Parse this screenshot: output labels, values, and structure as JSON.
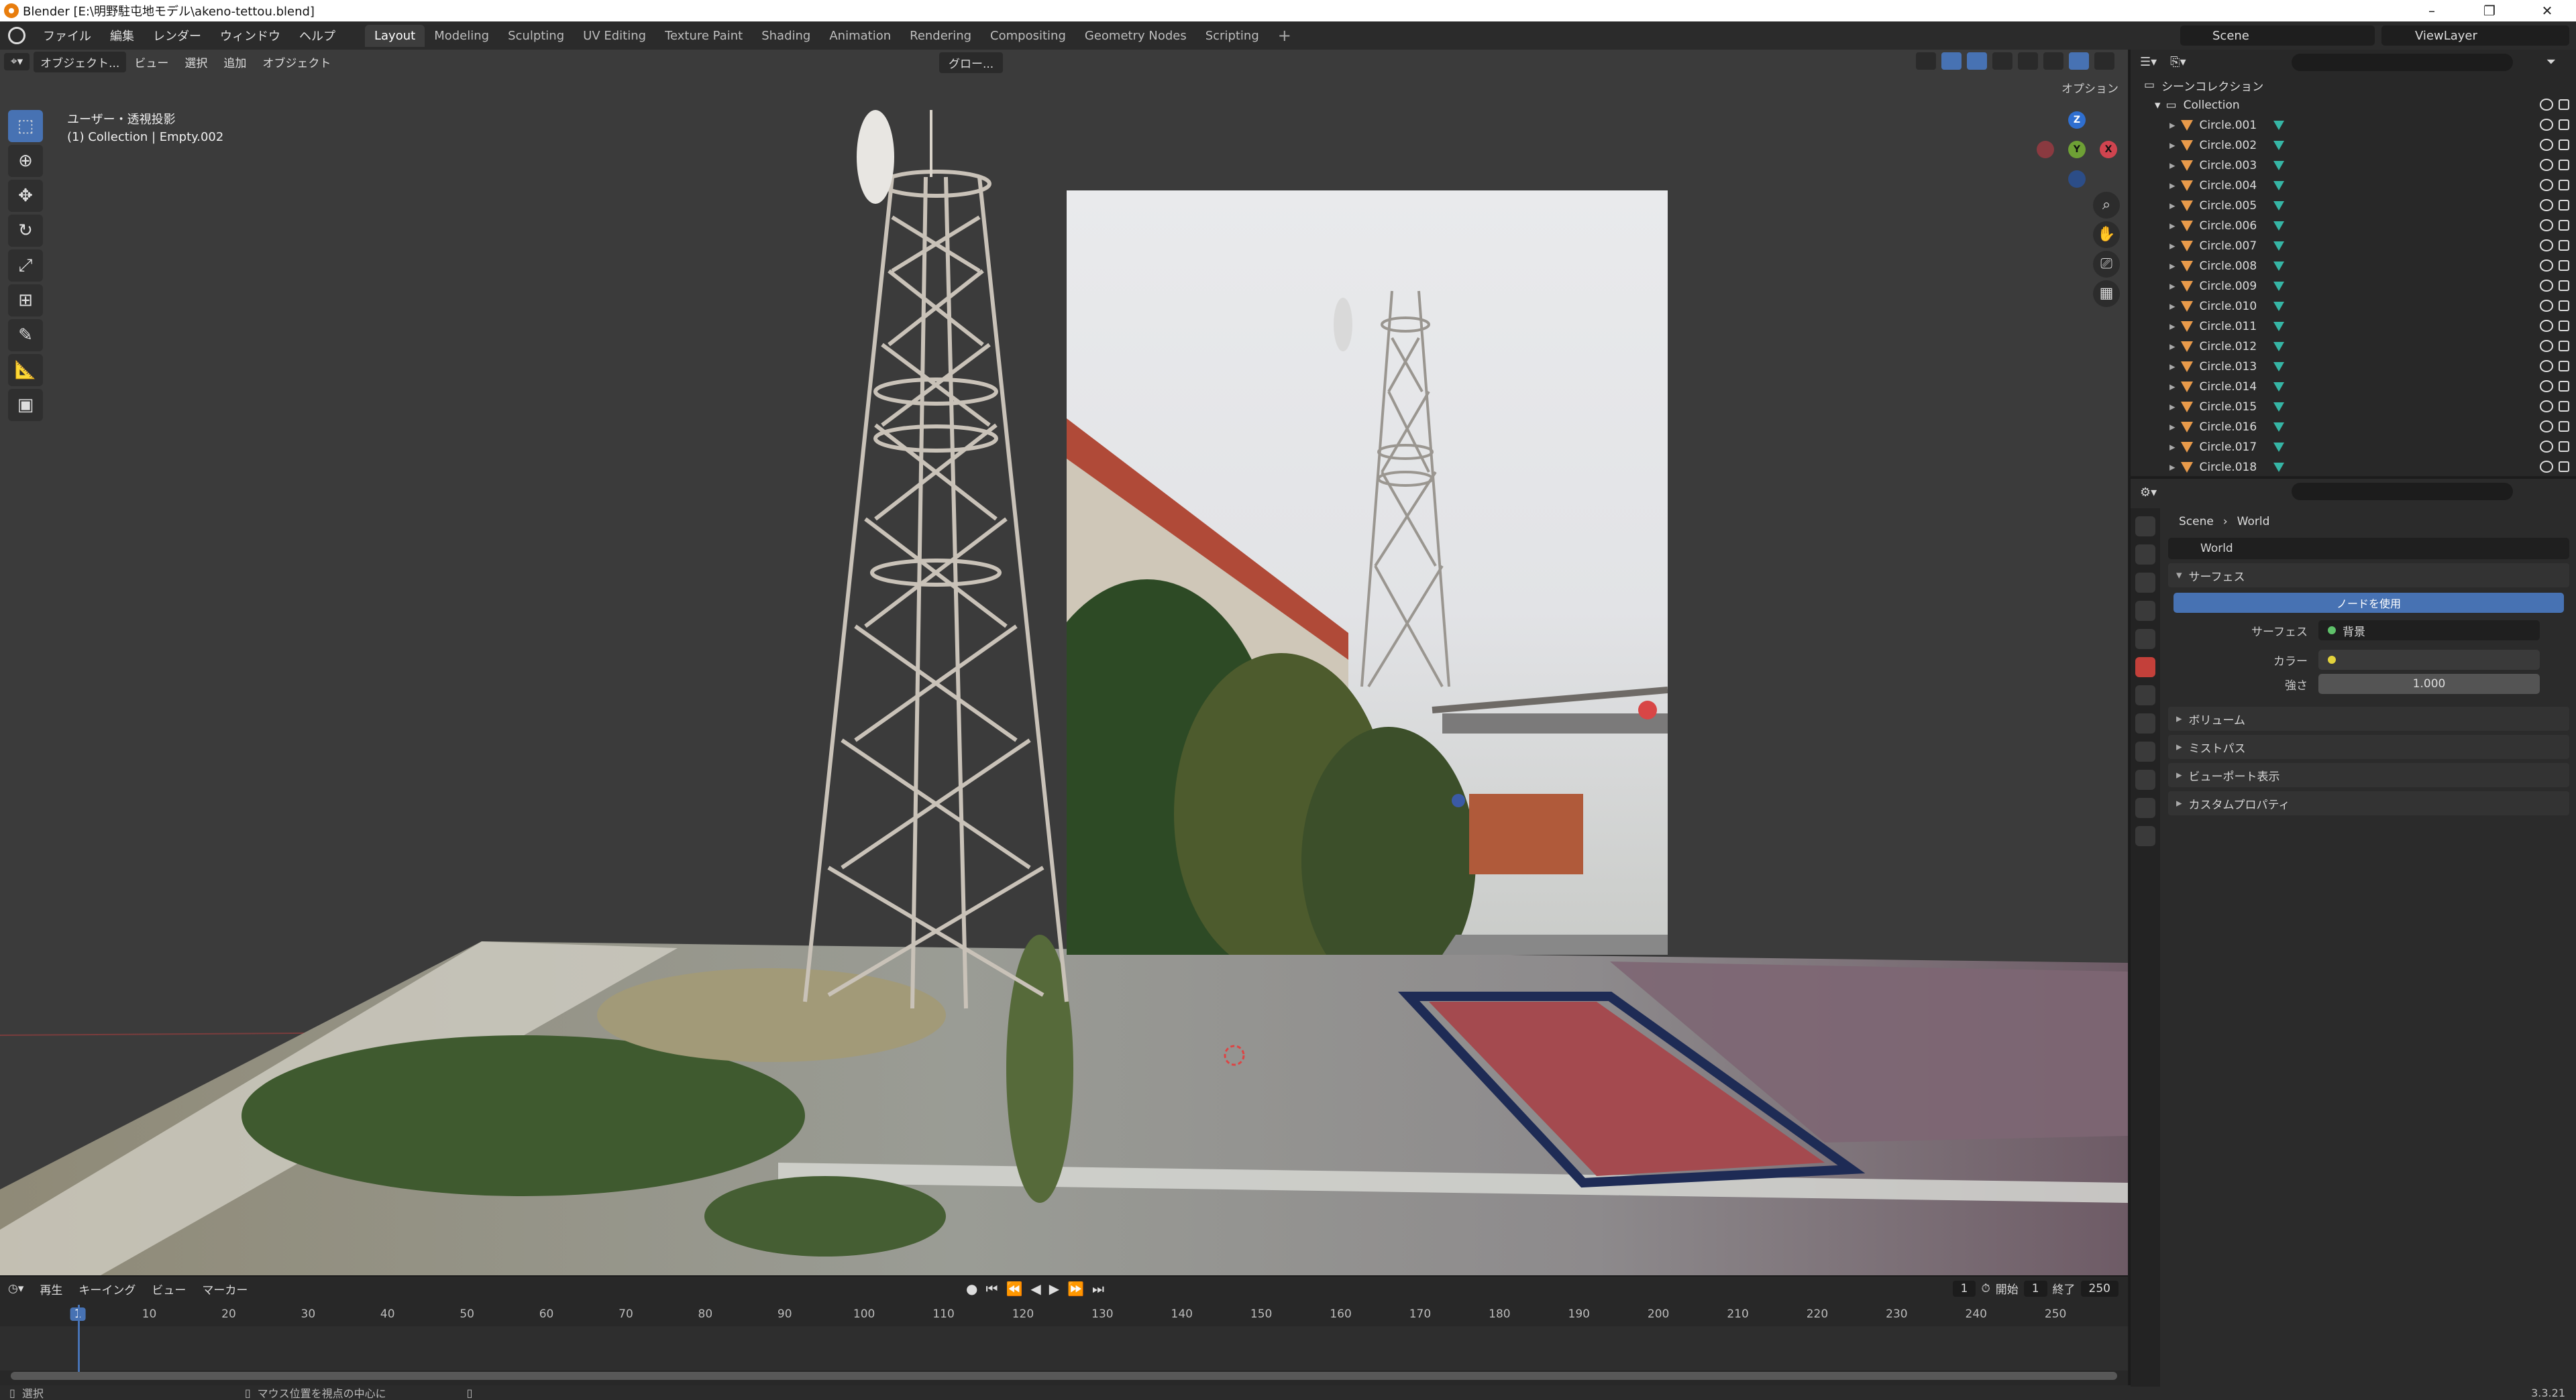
{
  "titlebar": {
    "title": "Blender [E:\\明野駐屯地モデル\\akeno-tettou.blend]"
  },
  "menus": [
    "ファイル",
    "編集",
    "レンダー",
    "ウィンドウ",
    "ヘルプ"
  ],
  "workspaces": [
    "Layout",
    "Modeling",
    "Sculpting",
    "UV Editing",
    "Texture Paint",
    "Shading",
    "Animation",
    "Rendering",
    "Compositing",
    "Geometry Nodes",
    "Scripting"
  ],
  "active_workspace": "Layout",
  "scene_name": "Scene",
  "view_layer": "ViewLayer",
  "viewport": {
    "mode": "オブジェクト...",
    "menus": [
      "ビュー",
      "選択",
      "追加",
      "オブジェクト"
    ],
    "transform": "グロー...",
    "options_label": "オプション",
    "info_line1": "ユーザー・透視投影",
    "info_line2": "(1) Collection | Empty.002",
    "gizmo_axes": {
      "x": "X",
      "y": "Y",
      "z": "Z"
    }
  },
  "timeline": {
    "menus": [
      "再生",
      "キーイング",
      "ビュー",
      "マーカー"
    ],
    "current_frame": "1",
    "start_label": "開始",
    "start": "1",
    "end_label": "終了",
    "end": "250",
    "ticks": [
      "1",
      "10",
      "20",
      "30",
      "40",
      "50",
      "60",
      "70",
      "80",
      "90",
      "100",
      "110",
      "120",
      "130",
      "140",
      "150",
      "160",
      "170",
      "180",
      "190",
      "200",
      "210",
      "220",
      "230",
      "240",
      "250"
    ]
  },
  "status": {
    "left": "選択",
    "middle": "マウス位置を視点の中心に",
    "version": "3.3.21"
  },
  "outliner": {
    "root": "シーンコレクション",
    "collection": "Collection",
    "items": [
      "Circle.001",
      "Circle.002",
      "Circle.003",
      "Circle.004",
      "Circle.005",
      "Circle.006",
      "Circle.007",
      "Circle.008",
      "Circle.009",
      "Circle.010",
      "Circle.011",
      "Circle.012",
      "Circle.013",
      "Circle.014",
      "Circle.015",
      "Circle.016",
      "Circle.017",
      "Circle.018"
    ]
  },
  "properties": {
    "breadcrumb_scene": "Scene",
    "breadcrumb_world": "World",
    "world_name": "World",
    "surface_section": "サーフェス",
    "use_nodes": "ノードを使用",
    "surface_label": "サーフェス",
    "surface_value": "背景",
    "color_label": "カラー",
    "strength_label": "強さ",
    "strength_value": "1.000",
    "sections": [
      "ボリューム",
      "ミストパス",
      "ビューポート表示",
      "カスタムプロパティ"
    ]
  },
  "colors": {
    "accent": "#4772b3",
    "object_icon": "#e89a4a",
    "mesh_icon": "#36b5a5",
    "world_tab": "#c3403a"
  }
}
